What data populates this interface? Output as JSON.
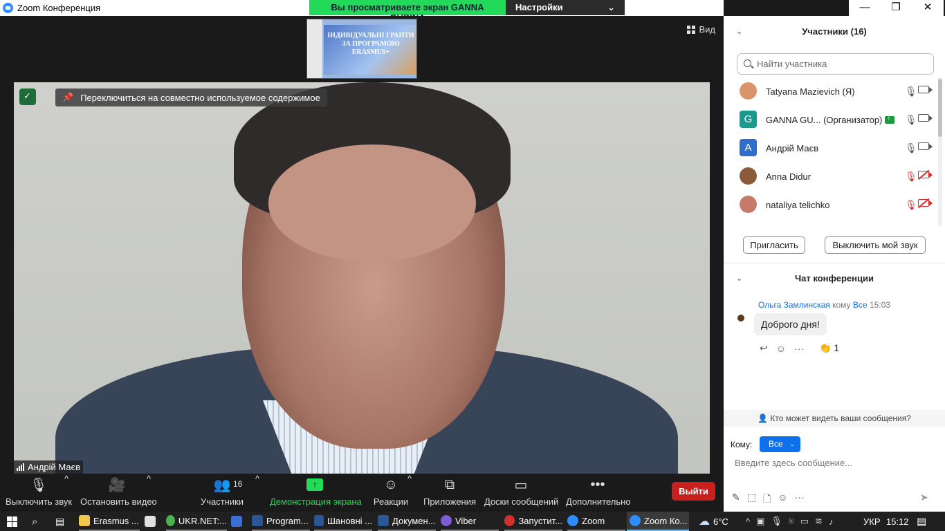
{
  "titlebar": {
    "title": "Zoom Конференция",
    "banner_text": "Вы просматриваете экран GANNA GUBINA",
    "view_settings": "Настройки просмотра",
    "minimize": "—",
    "restore": "❐",
    "close": "✕"
  },
  "stage": {
    "view_label": "Вид",
    "pin_text": "Переключиться на совместно используемое содержимое",
    "thumb_text": "ІНДИВІДУАЛЬНІ ГРАНТИ ЗА ПРОГРАМОЮ ERASMUS+",
    "speaker_name": "Андрій Маєв"
  },
  "toolbar": {
    "mute": "Выключить звук",
    "stop_video": "Остановить видео",
    "participants": "Участники",
    "participants_count": "16",
    "share": "Демонстрация экрана",
    "reactions": "Реакции",
    "apps": "Приложения",
    "whiteboards": "Доски сообщений",
    "more": "Дополнительно",
    "leave": "Выйти"
  },
  "participants_panel": {
    "title": "Участники (16)",
    "search_placeholder": "Найти участника",
    "items": [
      {
        "name": "Tatyana Mazievich (Я)",
        "avatar": "",
        "color": "#d9946a",
        "mic": "on",
        "cam": "off"
      },
      {
        "name": "GANNA GU... (Организатор)",
        "avatar": "G",
        "color": "#1a9a8f",
        "mic": "on",
        "cam": "off",
        "host": true
      },
      {
        "name": "Андрій Маєв",
        "avatar": "А",
        "color": "#2e6fc7",
        "mic": "on",
        "cam": "on"
      },
      {
        "name": "Anna Didur",
        "avatar": "",
        "color": "#8a5a3a",
        "mic": "muted",
        "cam": "muted"
      },
      {
        "name": "nataliya telichko",
        "avatar": "",
        "color": "#c77a6a",
        "mic": "muted",
        "cam": "muted"
      }
    ],
    "invite": "Пригласить",
    "mute_me": "Выключить мой звук"
  },
  "chat": {
    "title": "Чат конференции",
    "sender": "Ольга Замлинская",
    "to_word": "кому",
    "recipient": "Все",
    "time": "15:03",
    "message": "Доброго дня!",
    "reaction_count": "1",
    "who_sees": "Кто может видеть ваши сообщения?",
    "to_label": "Кому:",
    "to_value": "Все",
    "input_placeholder": "Введите здесь сообщение..."
  },
  "taskbar": {
    "items": [
      {
        "label": "Erasmus ...",
        "color": "#f2c94c"
      },
      {
        "label": "",
        "color": "#e0e0e0"
      },
      {
        "label": "UKR.NET:...",
        "color": "#4caf50"
      },
      {
        "label": "",
        "color": "#3b6fd8"
      },
      {
        "label": "Program...",
        "color": "#2b5797"
      },
      {
        "label": "Шановні ...",
        "color": "#2b5797"
      },
      {
        "label": "Докумен...",
        "color": "#2b5797"
      },
      {
        "label": "Viber",
        "color": "#7f5bd6"
      },
      {
        "label": "Запустит...",
        "color": "#d32f2f"
      },
      {
        "label": "Zoom",
        "color": "#2d8cff"
      },
      {
        "label": "Zoom Ко...",
        "color": "#2d8cff"
      }
    ],
    "weather": "6°C",
    "lang": "УКР",
    "clock": "15:12"
  }
}
